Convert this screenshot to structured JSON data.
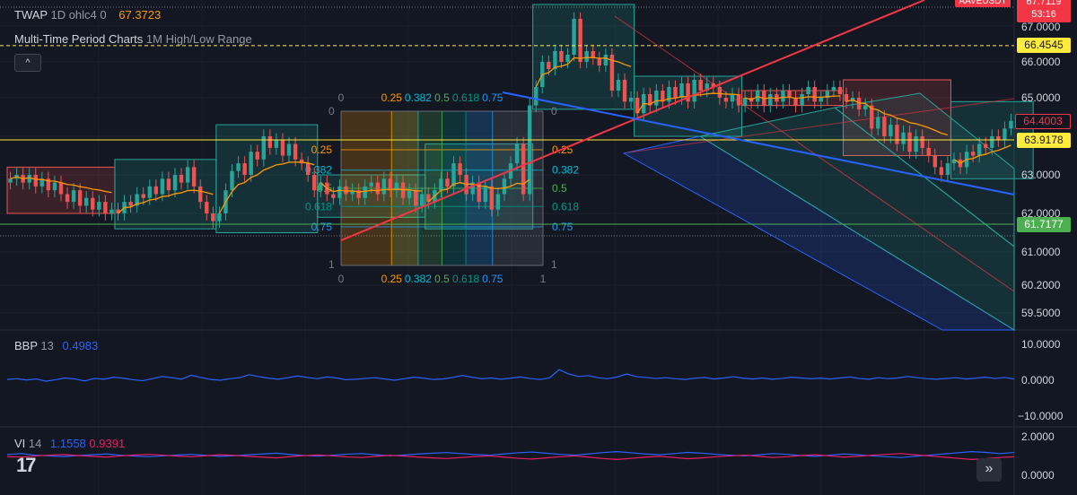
{
  "legend": {
    "twap": {
      "name": "TWAP",
      "params": "1D ohlc4 0",
      "value": "67.3723"
    },
    "mtp": {
      "name": "Multi-Time Period Charts",
      "params": "1M High/Low Range"
    },
    "bbp": {
      "name": "BBP",
      "params": "13",
      "value": "0.4983"
    },
    "vi": {
      "name": "VI",
      "params": "14",
      "plus": "1.1558",
      "minus": "0.9391"
    }
  },
  "symbol_badge": "AAVEUSDT",
  "countdown": "53:16",
  "collapse_label": "^",
  "nav_label": "»",
  "logo_text": "17",
  "colors": {
    "bg": "#131722",
    "up": "#26a69a",
    "down": "#ef5350",
    "twap": "#ff9800",
    "trend_red": "#f23645",
    "trend_blue": "#2962ff",
    "price_yellow": "#ffeb3b",
    "green_line": "#4caf50",
    "bbp": "#2962ff",
    "vi_plus": "#2962ff",
    "vi_minus": "#e91e63"
  },
  "price_axis": {
    "ticks": [
      "67.0000",
      "66.0000",
      "65.0000",
      "64.0000",
      "63.0000",
      "62.0000",
      "61.0000",
      "60.2000",
      "59.5000"
    ],
    "labels": [
      {
        "text": "67.7119",
        "color": "#f23645",
        "fg": "#ffffff"
      },
      {
        "text": "66.4545",
        "color": "#ffeb3b",
        "fg": "#131722"
      },
      {
        "text": "64.4003",
        "color": "#131722",
        "fg": "#f23645"
      },
      {
        "text": "63.9178",
        "color": "#ffeb3b",
        "fg": "#131722"
      },
      {
        "text": "61.7177",
        "color": "#4caf50",
        "fg": "#ffffff"
      }
    ]
  },
  "bbp_axis": {
    "ticks": [
      "10.0000",
      "0.0000",
      "−10.0000"
    ]
  },
  "vi_axis": {
    "ticks": [
      "2.0000",
      "0.0000"
    ]
  },
  "fib_grid": {
    "levels": [
      "0",
      "0.25",
      "0.382",
      "0.5",
      "0.618",
      "0.75",
      "1"
    ],
    "left_labels": [
      "0.25",
      "0.382",
      "0.5",
      "0.618",
      "0.75"
    ],
    "right_labels": [
      "0.25",
      "0.382",
      "0.5",
      "0.618",
      "0.75"
    ],
    "top_labels": [
      "0",
      "0.25",
      "0.382",
      "0.5",
      "0.618",
      "0.75"
    ],
    "bottom_labels": [
      "0",
      "0.25",
      "0.382",
      "0.5",
      "0.618",
      "0.75"
    ],
    "corner_top_left": "0",
    "corner_top_right": "0",
    "corner_bottom_left": "1",
    "corner_bottom_right": "1",
    "end_label": "1"
  },
  "chart_data": {
    "type": "candlestick",
    "title": "",
    "y_range": [
      59.2,
      67.9
    ],
    "horizontal_levels": [
      66.4545,
      63.9178,
      61.7177
    ],
    "monthly_ranges": [
      {
        "start": 0,
        "end": 16,
        "high": 63.2,
        "low": 62.0,
        "dir": "down"
      },
      {
        "start": 17,
        "end": 32,
        "high": 63.4,
        "low": 61.6,
        "dir": "up"
      },
      {
        "start": 33,
        "end": 48,
        "high": 64.3,
        "low": 61.5,
        "dir": "up"
      },
      {
        "start": 49,
        "end": 65,
        "high": 63.0,
        "low": 61.9,
        "dir": "up"
      },
      {
        "start": 66,
        "end": 82,
        "high": 63.8,
        "low": 61.6,
        "dir": "up"
      },
      {
        "start": 83,
        "end": 98,
        "high": 67.6,
        "low": 64.7,
        "dir": "up"
      },
      {
        "start": 99,
        "end": 115,
        "high": 65.6,
        "low": 64.0,
        "dir": "up"
      },
      {
        "start": 116,
        "end": 131,
        "high": 65.2,
        "low": 64.8,
        "dir": "down"
      },
      {
        "start": 132,
        "end": 148,
        "high": 65.5,
        "low": 63.5,
        "dir": "down"
      },
      {
        "start": 149,
        "end": 161,
        "high": 64.9,
        "low": 62.9,
        "dir": "up"
      }
    ],
    "closes": [
      62.9,
      63.0,
      62.8,
      63.0,
      62.7,
      62.9,
      62.6,
      62.8,
      62.5,
      62.3,
      62.6,
      62.2,
      62.4,
      62.1,
      62.3,
      62.0,
      62.1,
      62.0,
      62.3,
      62.2,
      62.5,
      62.4,
      62.7,
      62.5,
      62.9,
      62.6,
      63.0,
      62.8,
      63.2,
      62.7,
      62.3,
      62.0,
      61.8,
      62.0,
      62.6,
      63.1,
      63.3,
      63.0,
      63.6,
      63.4,
      64.0,
      63.7,
      63.9,
      63.5,
      63.8,
      63.4,
      63.3,
      63.0,
      62.6,
      62.8,
      62.5,
      62.4,
      62.7,
      62.5,
      62.6,
      62.4,
      62.7,
      62.8,
      62.5,
      62.9,
      62.6,
      62.8,
      62.4,
      62.6,
      62.2,
      62.5,
      62.3,
      62.6,
      62.9,
      62.7,
      63.3,
      63.0,
      62.5,
      62.8,
      62.3,
      62.7,
      62.1,
      62.5,
      62.9,
      63.3,
      63.8,
      62.5,
      64.8,
      65.3,
      66.0,
      65.8,
      66.3,
      66.0,
      66.2,
      67.2,
      66.0,
      66.3,
      66.1,
      65.9,
      66.2,
      65.2,
      65.5,
      64.9,
      65.0,
      64.6,
      65.1,
      64.8,
      65.2,
      64.9,
      65.3,
      65.0,
      65.4,
      64.9,
      65.5,
      65.2,
      65.4,
      65.3,
      65.0,
      64.9,
      65.1,
      64.8,
      65.0,
      64.9,
      65.2,
      64.8,
      65.1,
      64.9,
      65.2,
      65.0,
      64.8,
      65.1,
      65.3,
      64.9,
      65.0,
      65.2,
      65.3,
      65.1,
      64.9,
      65.0,
      64.7,
      64.8,
      64.2,
      64.5,
      64.0,
      64.3,
      63.8,
      64.1,
      63.6,
      64.0,
      63.7,
      63.5,
      63.2,
      63.0,
      63.3,
      63.4,
      63.2,
      63.6,
      63.5,
      63.8,
      63.7,
      64.0,
      63.9,
      64.2,
      64.4
    ],
    "bbp_values": [
      0.3,
      0.6,
      0.1,
      0.5,
      -0.4,
      0.2,
      0.9,
      0.5,
      -0.3,
      0.7,
      0.4,
      1.2,
      0.8,
      0.2,
      -0.2,
      0.6,
      1.5,
      1.0,
      0.4,
      2.0,
      1.1,
      0.3,
      0.0,
      0.6,
      1.0,
      2.2,
      1.4,
      0.8,
      0.4,
      1.0,
      1.7,
      1.1,
      0.6,
      1.3,
      0.9,
      0.2,
      0.4,
      0.7,
      1.0,
      0.5,
      0.0,
      0.6,
      1.2,
      0.8,
      0.3,
      0.5,
      1.1,
      1.9,
      1.2,
      0.6,
      0.9,
      0.4,
      0.8,
      1.3,
      0.7,
      0.3,
      0.9,
      4.2,
      2.5,
      1.5,
      1.8,
      1.0,
      0.6,
      1.3,
      2.5,
      1.4,
      1.1,
      0.7,
      1.0,
      0.6,
      0.3,
      0.8,
      1.1,
      0.5,
      0.9,
      1.4,
      0.8,
      0.5,
      0.9,
      0.4,
      0.7,
      1.2,
      0.9,
      0.6,
      0.8,
      0.5,
      0.9,
      1.3,
      0.7,
      0.4,
      1.0,
      0.6,
      0.9,
      1.5,
      1.0,
      0.6,
      0.4,
      0.7,
      1.0,
      0.5,
      0.8,
      1.2,
      0.7,
      1.1,
      0.4983
    ],
    "vi_plus": [
      1.05,
      1.1,
      1.02,
      0.98,
      0.95,
      1.0,
      1.04,
      1.08,
      1.02,
      0.97,
      0.94,
      0.98,
      1.03,
      1.06,
      1.01,
      0.96,
      0.99,
      1.04,
      1.08,
      1.12,
      1.05,
      1.0,
      0.97,
      1.02,
      1.07,
      1.1,
      1.04,
      0.99,
      1.03,
      1.08,
      1.12,
      1.15,
      1.1,
      1.05,
      1.02,
      1.08,
      1.14,
      1.18,
      1.12,
      1.06,
      1.02,
      1.08,
      1.15,
      1.2,
      1.14,
      1.08,
      1.04,
      1.1,
      1.16,
      1.12,
      1.06,
      1.02,
      0.98,
      1.04,
      1.1,
      1.06,
      1.0,
      0.96,
      1.02,
      1.08,
      1.04,
      0.98,
      0.94,
      0.9,
      0.96,
      1.02,
      1.08,
      1.14,
      1.2,
      1.16,
      1.1,
      1.1558
    ],
    "vi_minus": [
      0.95,
      0.92,
      0.98,
      1.02,
      1.05,
      1.0,
      0.96,
      0.92,
      0.98,
      1.03,
      1.06,
      1.02,
      0.97,
      0.94,
      0.99,
      1.04,
      1.01,
      0.96,
      0.92,
      0.88,
      0.95,
      1.0,
      1.03,
      0.98,
      0.93,
      0.9,
      0.96,
      1.01,
      0.97,
      0.92,
      0.88,
      0.85,
      0.9,
      0.95,
      0.98,
      0.92,
      0.86,
      0.82,
      0.88,
      0.94,
      0.98,
      0.92,
      0.85,
      0.8,
      0.86,
      0.92,
      0.96,
      0.9,
      0.84,
      0.88,
      0.94,
      0.98,
      1.02,
      0.96,
      0.9,
      0.94,
      1.0,
      1.04,
      0.98,
      0.92,
      0.96,
      1.02,
      1.06,
      1.1,
      1.04,
      0.98,
      0.92,
      0.86,
      0.8,
      0.84,
      0.9,
      0.9391
    ]
  }
}
